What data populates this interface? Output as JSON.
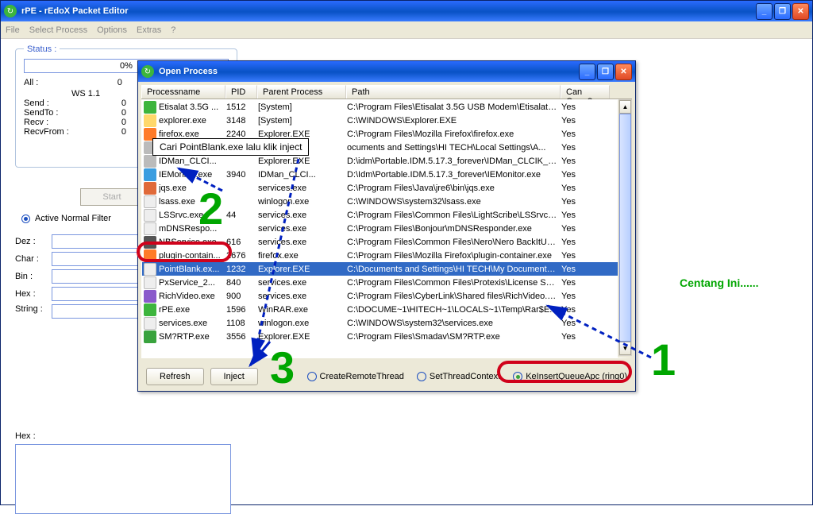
{
  "main": {
    "title": "rPE - rEdoX Packet Editor",
    "menu": [
      "File",
      "Select Process",
      "Options",
      "Extras",
      "?"
    ]
  },
  "status": {
    "legend": "Status :",
    "progress": "0%",
    "all_label": "All :",
    "all_val": "0",
    "ws_left": "WS 1.1",
    "ws_right": "WS",
    "send_label": "Send :",
    "send_val": "0",
    "sendto_label": "SendTo :",
    "sendto_val": "0",
    "recv_label": "Recv :",
    "recv_val": "0",
    "recvfrom_label": "RecvFrom :",
    "recvfrom_val": "0"
  },
  "start_label": "Start",
  "filter_label": "Active Normal Filter",
  "fields": {
    "dez": "Dez :",
    "char": "Char :",
    "bin": "Bin :",
    "hex": "Hex :",
    "string": "String :",
    "hex2": "Hex :"
  },
  "dialog": {
    "title": "Open Process",
    "headers": {
      "name": "Processname",
      "pid": "PID",
      "parent": "Parent Process",
      "path": "Path",
      "open": "Can Open?"
    },
    "refresh": "Refresh",
    "inject": "Inject",
    "radios": {
      "r1": "CreateRemoteThread",
      "r2": "SetThreadContext",
      "r3": "KeInsertQueueApc (ring0)"
    }
  },
  "rows": [
    {
      "ico": "ic-green",
      "name": "Etisalat 3.5G ...",
      "pid": "1512",
      "parent": "[System]",
      "path": "C:\\Program Files\\Etisalat 3.5G USB Modem\\Etisalat 3.5...",
      "open": "Yes"
    },
    {
      "ico": "ic-folder",
      "name": "explorer.exe",
      "pid": "3148",
      "parent": "[System]",
      "path": "C:\\WINDOWS\\Explorer.EXE",
      "open": "Yes"
    },
    {
      "ico": "ic-ff",
      "name": "firefox.exe",
      "pid": "2240",
      "parent": "Explorer.EXE",
      "path": "C:\\Program Files\\Mozilla Firefox\\firefox.exe",
      "open": "Yes"
    },
    {
      "ico": "ic-grey",
      "name": "",
      "pid": "",
      "parent": "",
      "path": "ocuments and Settings\\HI TECH\\Local Settings\\A...",
      "open": "Yes"
    },
    {
      "ico": "ic-grey",
      "name": "IDMan_CLCI...",
      "pid": "",
      "parent": "Explorer.EXE",
      "path": "D:\\idm\\Portable.IDM.5.17.3_forever\\IDMan_CLCIK_H...",
      "open": "Yes"
    },
    {
      "ico": "ic-ie",
      "name": "IEMonitor.exe",
      "pid": "3940",
      "parent": "IDMan_CLCI...",
      "path": "D:\\Idm\\Portable.IDM.5.17.3_forever\\IEMonitor.exe",
      "open": "Yes"
    },
    {
      "ico": "ic-java",
      "name": "jqs.exe",
      "pid": "",
      "parent": "services.exe",
      "path": "C:\\Program Files\\Java\\jre6\\bin\\jqs.exe",
      "open": "Yes"
    },
    {
      "ico": "ic-white",
      "name": "lsass.exe",
      "pid": "",
      "parent": "winlogon.exe",
      "path": "C:\\WINDOWS\\system32\\lsass.exe",
      "open": "Yes"
    },
    {
      "ico": "ic-white",
      "name": "LSSrvc.exe",
      "pid": "44",
      "parent": "services.exe",
      "path": "C:\\Program Files\\Common Files\\LightScribe\\LSSrvc.exe",
      "open": "Yes"
    },
    {
      "ico": "ic-white",
      "name": "mDNSRespo...",
      "pid": "",
      "parent": "services.exe",
      "path": "C:\\Program Files\\Bonjour\\mDNSResponder.exe",
      "open": "Yes"
    },
    {
      "ico": "ic-dark",
      "name": "NBService.exe",
      "pid": "616",
      "parent": "services.exe",
      "path": "C:\\Program Files\\Common Files\\Nero\\Nero BackItUp 4...",
      "open": "Yes"
    },
    {
      "ico": "ic-ff",
      "name": "plugin-contain...",
      "pid": "2676",
      "parent": "firefox.exe",
      "path": "C:\\Program Files\\Mozilla Firefox\\plugin-container.exe",
      "open": "Yes"
    },
    {
      "ico": "ic-white",
      "name": "PointBlank.ex...",
      "pid": "1232",
      "parent": "Explorer.EXE",
      "path": "C:\\Documents and Settings\\HI TECH\\My Documents\\...",
      "open": "Yes",
      "sel": true
    },
    {
      "ico": "ic-white",
      "name": "PxService_2...",
      "pid": "840",
      "parent": "services.exe",
      "path": "C:\\Program Files\\Common Files\\Protexis\\License Servi...",
      "open": "Yes"
    },
    {
      "ico": "ic-purple",
      "name": "RichVideo.exe",
      "pid": "900",
      "parent": "services.exe",
      "path": "C:\\Program Files\\CyberLink\\Shared files\\RichVideo.exe",
      "open": "Yes"
    },
    {
      "ico": "ic-green",
      "name": "rPE.exe",
      "pid": "1596",
      "parent": "WinRAR.exe",
      "path": "C:\\DOCUME~1\\HITECH~1\\LOCALS~1\\Temp\\Rar$E...",
      "open": "Yes"
    },
    {
      "ico": "ic-white",
      "name": "services.exe",
      "pid": "1108",
      "parent": "winlogon.exe",
      "path": "C:\\WINDOWS\\system32\\services.exe",
      "open": "Yes"
    },
    {
      "ico": "ic-smadav",
      "name": "SM?RTP.exe",
      "pid": "3556",
      "parent": "Explorer.EXE",
      "path": "C:\\Program Files\\Smadav\\SM?RTP.exe",
      "open": "Yes"
    }
  ],
  "annot": {
    "tooltip": "Cari PointBlank.exe lalu klik inject",
    "centang": "Centang Ini......",
    "n1": "1",
    "n2": "2",
    "n3": "3"
  }
}
